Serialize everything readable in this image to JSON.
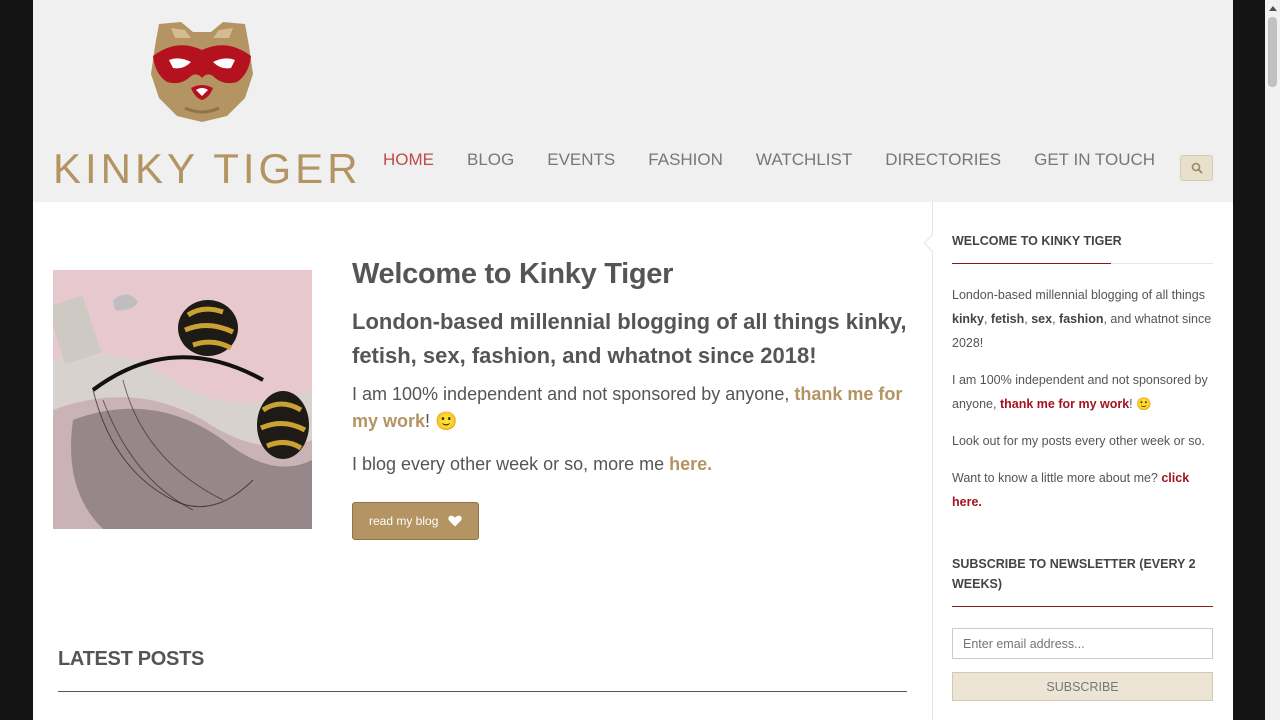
{
  "header": {
    "logo_text": "KINKY TIGER",
    "nav": [
      "HOME",
      "BLOG",
      "EVENTS",
      "FASHION",
      "WATCHLIST",
      "DIRECTORIES",
      "GET IN TOUCH"
    ],
    "active_nav": "HOME",
    "search_icon": "search-icon"
  },
  "hero": {
    "title": "Welcome to Kinky Tiger",
    "subtitle": "London-based millennial blogging of all things kinky, fetish, sex, fashion, and whatnot since 2018!",
    "line1_pre": "I am 100% independent and not sponsored by anyone, ",
    "line1_link": "thank me for my work",
    "line1_post": "! 🙂",
    "line2_pre": "I blog every other week or so, more me ",
    "line2_link": "here",
    "line2_post": ".",
    "button_label": "read my blog",
    "button_icon": "heart-icon"
  },
  "latest": {
    "title": "LATEST POSTS"
  },
  "sidebar": {
    "welcome_title": "WELCOME TO KINKY TIGER",
    "p1_pre": "London-based millennial blogging of all things ",
    "p1_kinky": "kinky",
    "p1_comma1": ", ",
    "p1_fetish": "fetish",
    "p1_comma2": ", ",
    "p1_sex": "sex",
    "p1_comma3": ", ",
    "p1_fashion": "fashion",
    "p1_post": ", and whatnot since 2028!",
    "p2_pre": "I am 100% independent and not sponsored by anyone, ",
    "p2_link": "thank me for my work",
    "p2_post": "! 🙂",
    "p3": "Look out for my posts every other week or so.",
    "p4_pre": "Want to know a little more about me? ",
    "p4_link": "click here.",
    "newsletter_title": "SUBSCRIBE TO NEWSLETTER (EVERY 2 WEEKS)",
    "email_placeholder": "Enter email address...",
    "subscribe_label": "SUBSCRIBE"
  },
  "colors": {
    "gold": "#b39462",
    "active_nav": "#c14a4a",
    "deep_red": "#a3141e",
    "header_bg": "#f0f0f0"
  }
}
